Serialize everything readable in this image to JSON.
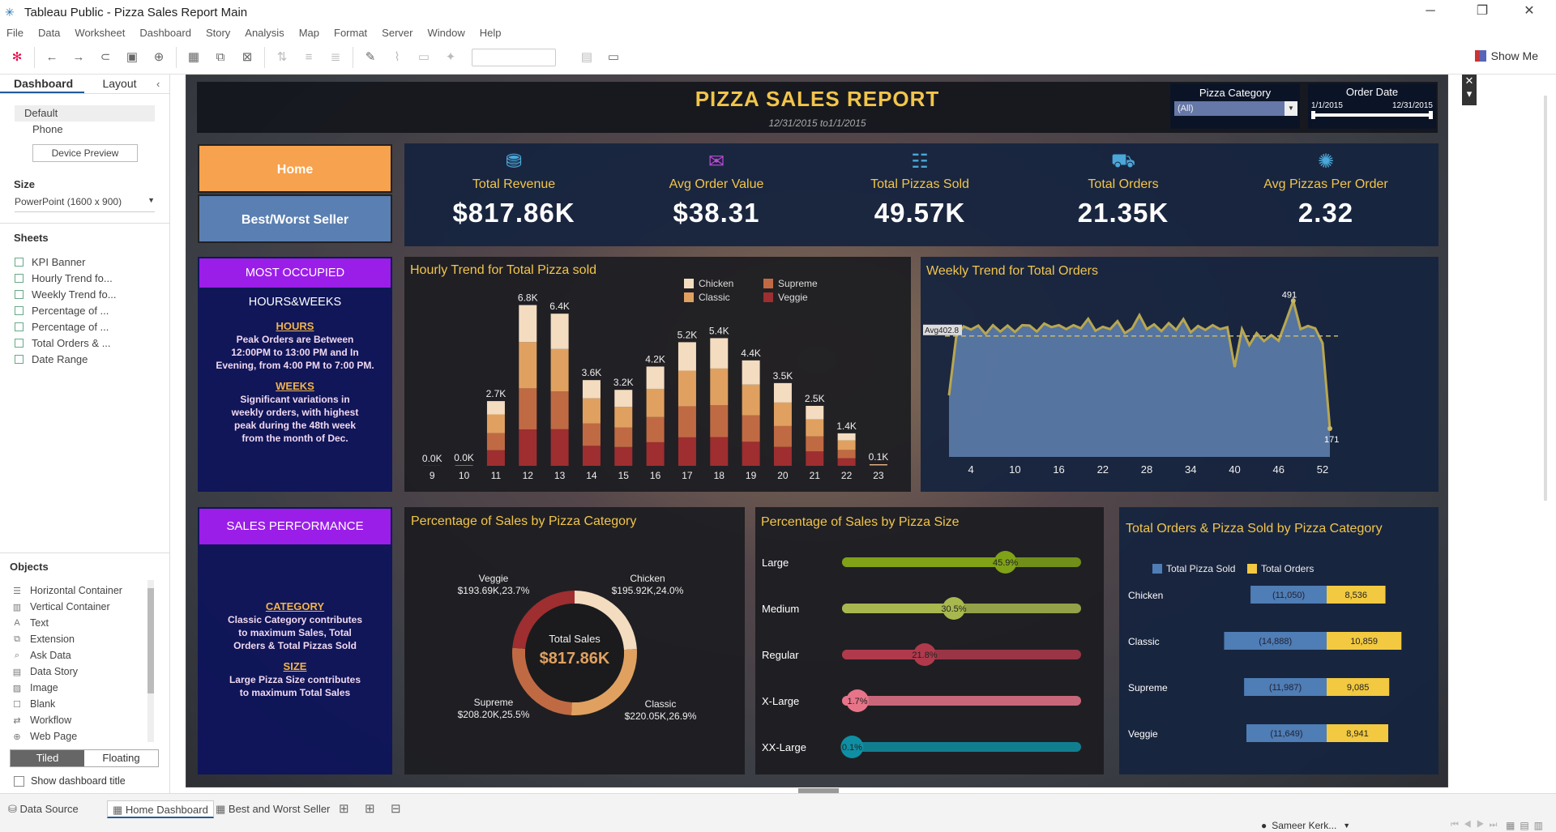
{
  "window": {
    "title": "Tableau Public - Pizza Sales Report Main"
  },
  "menu": [
    "File",
    "Data",
    "Worksheet",
    "Dashboard",
    "Story",
    "Analysis",
    "Map",
    "Format",
    "Server",
    "Window",
    "Help"
  ],
  "toolbar": {
    "show_me": "Show Me"
  },
  "left_panel": {
    "tabs": [
      "Dashboard",
      "Layout"
    ],
    "devices": [
      "Default",
      "Phone"
    ],
    "device_preview": "Device Preview",
    "size_label": "Size",
    "size_value": "PowerPoint (1600 x 900)",
    "sheets_label": "Sheets",
    "sheets": [
      "KPI Banner",
      "Hourly Trend fo...",
      "Weekly Trend fo...",
      "Percentage of ...",
      "Percentage of ...",
      "Total Orders & ...",
      "Date Range"
    ],
    "objects_label": "Objects",
    "objects": [
      {
        "label": "Horizontal Container",
        "icon": "horizontal-container-icon",
        "glyph": "☰"
      },
      {
        "label": "Vertical Container",
        "icon": "vertical-container-icon",
        "glyph": "▥"
      },
      {
        "label": "Text",
        "icon": "text-icon",
        "glyph": "A"
      },
      {
        "label": "Extension",
        "icon": "extension-icon",
        "glyph": "⧉"
      },
      {
        "label": "Ask Data",
        "icon": "ask-data-icon",
        "glyph": "⌕"
      },
      {
        "label": "Data Story",
        "icon": "data-story-icon",
        "glyph": "▤"
      },
      {
        "label": "Image",
        "icon": "image-icon",
        "glyph": "▨"
      },
      {
        "label": "Blank",
        "icon": "blank-icon",
        "glyph": "☐"
      },
      {
        "label": "Workflow",
        "icon": "workflow-icon",
        "glyph": "⇄"
      },
      {
        "label": "Web Page",
        "icon": "web-page-icon",
        "glyph": "⊕"
      }
    ],
    "tiled": "Tiled",
    "floating": "Floating",
    "show_title": "Show dashboard title"
  },
  "dashboard": {
    "title": "PIZZA SALES REPORT",
    "subtitle": "12/31/2015 to1/1/2015",
    "filter_category": {
      "label": "Pizza Category",
      "value": "(All)"
    },
    "filter_date": {
      "label": "Order Date",
      "start": "1/1/2015",
      "end": "12/31/2015"
    },
    "nav": {
      "home": "Home",
      "best_worst": "Best/Worst Seller"
    },
    "kpis": [
      {
        "label": "Total Revenue",
        "value": "$817.86K",
        "icon": "revenue-icon"
      },
      {
        "label": "Avg Order Value",
        "value": "$38.31",
        "icon": "order-value-icon"
      },
      {
        "label": "Total Pizzas Sold",
        "value": "49.57K",
        "icon": "pizzas-sold-icon"
      },
      {
        "label": "Total Orders",
        "value": "21.35K",
        "icon": "orders-icon"
      },
      {
        "label": "Avg Pizzas Per Order",
        "value": "2.32",
        "icon": "avg-pizzas-icon"
      }
    ],
    "occupied": {
      "title": "MOST OCCUPIED HOURS&WEEKS",
      "hours_head": "HOURS",
      "hours_text": [
        "Peak Orders are Between",
        "12:00PM to 13:00 PM and In",
        "Evening, from 4:00 PM to 7:00 PM."
      ],
      "weeks_head": "WEEKS",
      "weeks_text": [
        "Significant variations in",
        "weekly orders, with highest",
        "peak during the 48th week",
        "from the month of Dec."
      ]
    },
    "sales_perf": {
      "title": "SALES PERFORMANCE",
      "cat_head": "CATEGORY",
      "cat_text": [
        "Classic Category contributes",
        "to maximum Sales, Total",
        "Orders & Total Pizzas Sold"
      ],
      "size_head": "SIZE",
      "size_text": [
        "Large Pizza Size contributes",
        "to maximum Total Sales"
      ]
    },
    "colors": {
      "chicken": "#f3dcc0",
      "classic": "#e0a160",
      "supreme": "#c06a44",
      "veggie": "#9e2e30",
      "accent": "#f2c54b",
      "blue": "#4f7db5",
      "yellow": "#f2c940"
    }
  },
  "chart_data": [
    {
      "type": "bar",
      "title": "Hourly Trend for Total Pizza sold",
      "categories": [
        "9",
        "10",
        "11",
        "12",
        "13",
        "14",
        "15",
        "16",
        "17",
        "18",
        "19",
        "20",
        "21",
        "22",
        "23"
      ],
      "totals_labels": [
        "0.0K",
        "0.0K",
        "2.7K",
        "6.8K",
        "6.4K",
        "3.6K",
        "3.2K",
        "4.2K",
        "5.2K",
        "5.4K",
        "4.4K",
        "3.5K",
        "2.5K",
        "1.4K",
        "0.1K"
      ],
      "totals": [
        4,
        28,
        2728,
        6776,
        6413,
        3613,
        3202,
        4185,
        5211,
        5381,
        4444,
        3487,
        2528,
        1370,
        68
      ],
      "series": [
        {
          "name": "Chicken",
          "values": [
            1,
            6,
            560,
            1560,
            1490,
            770,
            720,
            940,
            1200,
            1280,
            1020,
            820,
            570,
            300,
            15
          ]
        },
        {
          "name": "Classic",
          "values": [
            1,
            8,
            790,
            1950,
            1790,
            1060,
            870,
            1190,
            1500,
            1540,
            1290,
            990,
            720,
            400,
            20
          ]
        },
        {
          "name": "Supreme",
          "values": [
            1,
            7,
            720,
            1730,
            1590,
            940,
            820,
            1060,
            1310,
            1350,
            1120,
            880,
            630,
            350,
            17
          ]
        },
        {
          "name": "Veggie",
          "values": [
            1,
            7,
            658,
            1536,
            1543,
            843,
            792,
            995,
            1201,
            1211,
            1014,
            797,
            608,
            320,
            16
          ]
        }
      ],
      "legend": [
        "Chicken",
        "Supreme",
        "Classic",
        "Veggie"
      ],
      "legend_position": "top-right"
    },
    {
      "type": "area",
      "title": "Weekly Trend for Total Orders",
      "x_ticks": [
        "4",
        "10",
        "16",
        "22",
        "28",
        "34",
        "40",
        "46",
        "52"
      ],
      "reference_line": {
        "label": "Avg402.8",
        "value": 402.8
      },
      "max_label": "491",
      "min_label": "171",
      "x": [
        1,
        2,
        3,
        4,
        5,
        6,
        7,
        8,
        9,
        10,
        11,
        12,
        13,
        14,
        15,
        16,
        17,
        18,
        19,
        20,
        21,
        22,
        23,
        24,
        25,
        26,
        27,
        28,
        29,
        30,
        31,
        32,
        33,
        34,
        35,
        36,
        37,
        38,
        39,
        40,
        41,
        42,
        43,
        44,
        45,
        46,
        47,
        48,
        49,
        50,
        51,
        52,
        53
      ],
      "values": [
        254,
        403,
        427,
        419,
        429,
        408,
        430,
        414,
        429,
        413,
        430,
        429,
        414,
        434,
        425,
        430,
        420,
        430,
        422,
        446,
        416,
        426,
        420,
        440,
        410,
        422,
        455,
        420,
        432,
        415,
        435,
        418,
        445,
        412,
        428,
        418,
        430,
        420,
        425,
        325,
        420,
        380,
        410,
        390,
        405,
        391,
        440,
        491,
        420,
        428,
        422,
        385,
        171
      ]
    },
    {
      "type": "pie",
      "title": "Percentage of Sales by Pizza Category",
      "center_label": "Total Sales",
      "center_value": "$817.86K",
      "slices": [
        {
          "name": "Chicken",
          "value": 24.0,
          "label": "$195.92K,24.0%"
        },
        {
          "name": "Classic",
          "value": 26.9,
          "label": "$220.05K,26.9%"
        },
        {
          "name": "Supreme",
          "value": 25.5,
          "label": "$208.20K,25.5%"
        },
        {
          "name": "Veggie",
          "value": 23.7,
          "label": "$193.69K,23.7%"
        }
      ]
    },
    {
      "type": "bar",
      "title": "Percentage of Sales by Pizza Size",
      "categories": [
        "Large",
        "Medium",
        "Regular",
        "X-Large",
        "XX-Large"
      ],
      "values": [
        45.9,
        30.5,
        21.8,
        1.7,
        0.1
      ],
      "labels": [
        "45.9%",
        "30.5%",
        "21.8%",
        "1.7%",
        "0.1%"
      ],
      "colors": [
        "#7fa217",
        "#a8b84f",
        "#b03a4c",
        "#e87489",
        "#0f8fa3"
      ],
      "track_colors": [
        "#7fa217",
        "#a8b84f",
        "#b03a4c",
        "#e87489",
        "#0f8fa3"
      ]
    },
    {
      "type": "bar",
      "title": "Total Orders & Pizza Sold by Pizza Category",
      "categories": [
        "Chicken",
        "Classic",
        "Supreme",
        "Veggie"
      ],
      "series": [
        {
          "name": "Total Pizza Sold",
          "values": [
            11050,
            14888,
            11987,
            11649
          ],
          "labels": [
            "(11,050)",
            "(14,888)",
            "(11,987)",
            "(11,649)"
          ]
        },
        {
          "name": "Total Orders",
          "values": [
            8536,
            10859,
            9085,
            8941
          ],
          "labels": [
            "8,536",
            "10,859",
            "9,085",
            "8,941"
          ]
        }
      ]
    }
  ],
  "status": {
    "tabs": [
      "Data Source",
      "Home Dashboard",
      "Best and Worst Seller"
    ],
    "user": "Sameer Kerk..."
  }
}
